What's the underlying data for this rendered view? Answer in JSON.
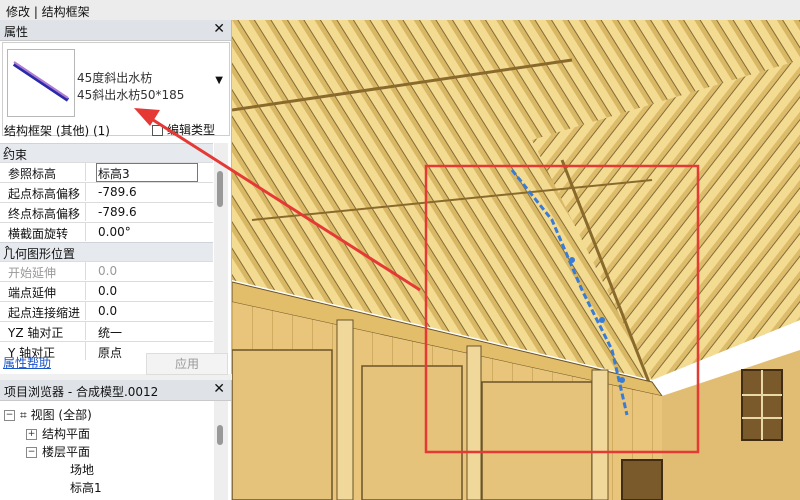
{
  "window": {
    "title": "修改 | 结构框架"
  },
  "properties": {
    "header": "属性",
    "type_line1": "45度斜出水枋",
    "type_line2": "45斜出水枋50*185",
    "filter": "结构框架 (其他) (1)",
    "edit_type": "编辑类型",
    "groups": [
      {
        "name": "约束",
        "rows": [
          {
            "key": "参照标高",
            "value": "标高3"
          },
          {
            "key": "起点标高偏移",
            "value": "-789.6"
          },
          {
            "key": "终点标高偏移",
            "value": "-789.6"
          },
          {
            "key": "横截面旋转",
            "value": "0.00°"
          }
        ]
      },
      {
        "name": "几何图形位置",
        "rows": [
          {
            "key": "开始延伸",
            "value": "0.0"
          },
          {
            "key": "端点延伸",
            "value": "0.0"
          },
          {
            "key": "起点连接缩进",
            "value": "0.0"
          },
          {
            "key": "YZ 轴对正",
            "value": "统一"
          },
          {
            "key": "Y 轴对正",
            "value": "原点"
          }
        ]
      }
    ],
    "help": "属性帮助",
    "apply": "应用"
  },
  "browser": {
    "header": "项目浏览器 - 合成模型.0012",
    "items": [
      "视图 (全部)",
      "结构平面",
      "楼层平面",
      "场地",
      "标高1"
    ]
  },
  "colors": {
    "accent": "#e53935",
    "wood": "#f2d98c",
    "selection": "#3a7bd5"
  }
}
